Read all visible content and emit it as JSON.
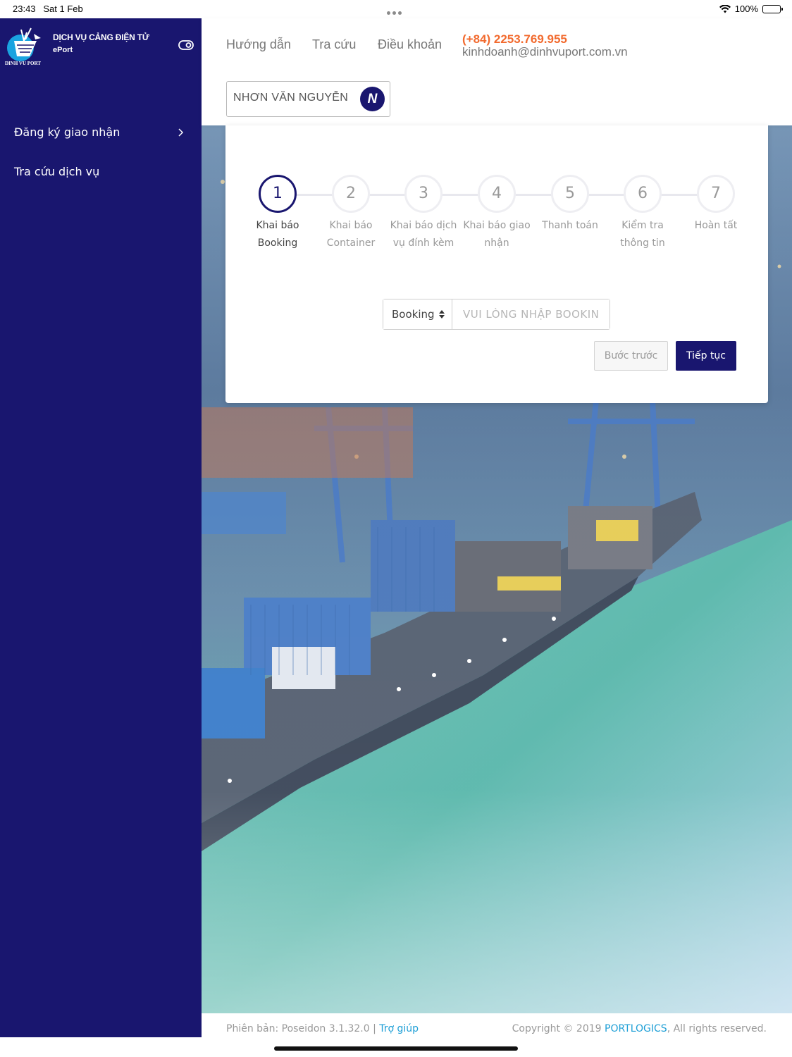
{
  "status_bar": {
    "time": "23:43",
    "date": "Sat 1 Feb",
    "battery": "100%"
  },
  "brand": {
    "title": "DỊCH VỤ CẢNG ĐIỆN TỬ",
    "subtitle": "ePort",
    "logo_text": "DINH VU PORT"
  },
  "sidebar": {
    "items": [
      {
        "label": "Đăng ký giao nhận",
        "has_chevron": true
      },
      {
        "label": "Tra cứu dịch vụ",
        "has_chevron": false
      }
    ]
  },
  "header": {
    "nav": [
      "Hướng dẫn",
      "Tra cứu",
      "Điều khoản"
    ],
    "phone": "(+84) 2253.769.955",
    "email": "kinhdoanh@dinhvuport.com.vn",
    "user_name": "NHƠN VĂN NGUYỄN",
    "user_initial": "N"
  },
  "wizard": {
    "current_step": 1,
    "steps": [
      {
        "number": "1",
        "label_line1": "Khai báo",
        "label_line2": "Booking"
      },
      {
        "number": "2",
        "label_line1": "Khai báo",
        "label_line2": "Container"
      },
      {
        "number": "3",
        "label_line1": "Khai báo dịch",
        "label_line2": "vụ đính kèm"
      },
      {
        "number": "4",
        "label_line1": "Khai báo giao",
        "label_line2": "nhận"
      },
      {
        "number": "5",
        "label_line1": "Thanh toán",
        "label_line2": ""
      },
      {
        "number": "6",
        "label_line1": "Kiểm tra",
        "label_line2": "thông tin"
      },
      {
        "number": "7",
        "label_line1": "Hoàn tất",
        "label_line2": ""
      }
    ],
    "booking_select": "Booking",
    "booking_placeholder": "VUI LÒNG NHẬP BOOKIN",
    "prev_label": "Bước trước",
    "next_label": "Tiếp tục"
  },
  "footer": {
    "version_label": "Phiên bản: Poseidon 3.1.32.0 |",
    "help_link": "Trợ giúp",
    "copyright_pre": "Copyright © 2019",
    "company_link": "PORTLOGICS",
    "copyright_post": ", All rights reserved."
  },
  "colors": {
    "primary": "#19166f",
    "accent": "#f26a2e",
    "link": "#1e9fd6"
  }
}
